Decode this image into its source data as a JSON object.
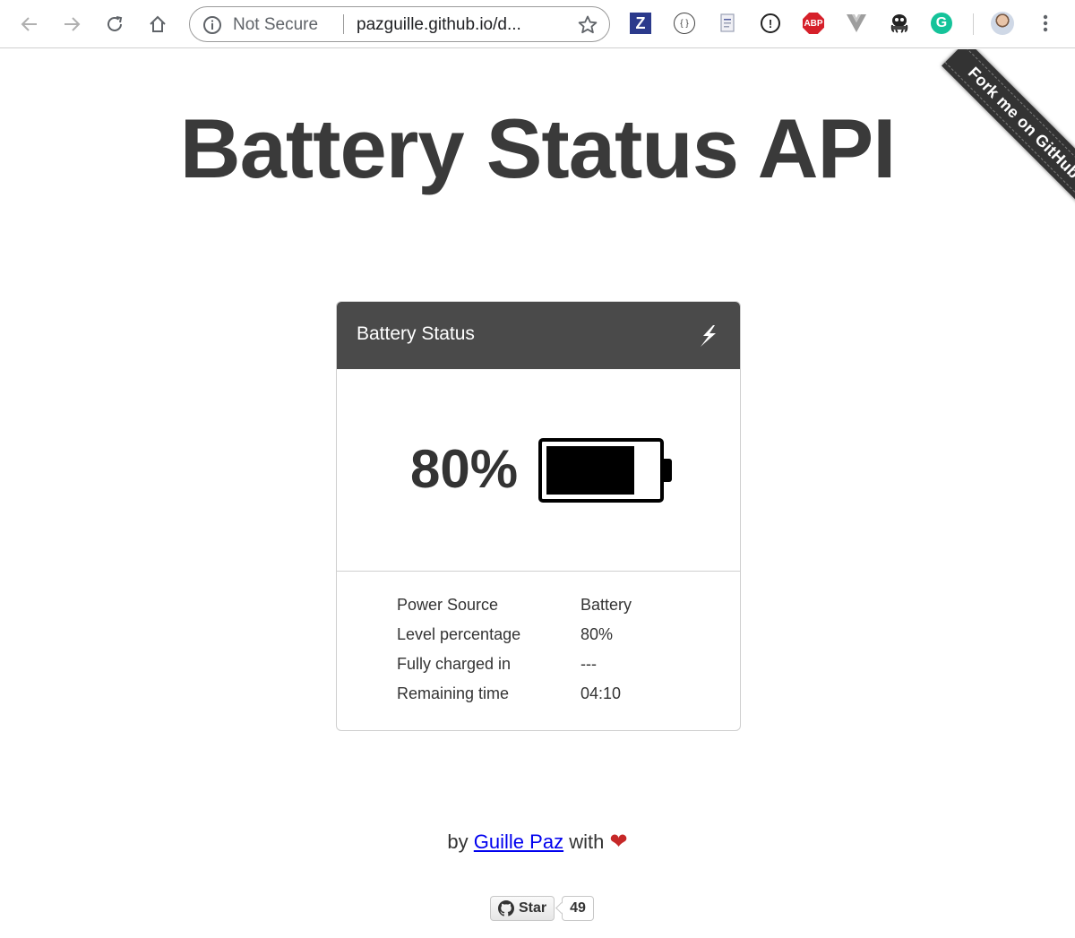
{
  "browser": {
    "security_label": "Not Secure",
    "url": "pazguille.github.io/d...",
    "extensions": [
      {
        "name": "zotero-icon",
        "label": "Z"
      },
      {
        "name": "json-viewer-icon",
        "label": "{ }"
      },
      {
        "name": "document-extension-icon",
        "label": ""
      },
      {
        "name": "password-manager-icon",
        "label": "!"
      },
      {
        "name": "adblock-plus-icon",
        "label": "ABP"
      },
      {
        "name": "vue-devtools-icon",
        "label": ""
      },
      {
        "name": "octopus-extension-icon",
        "label": ""
      },
      {
        "name": "grammarly-icon",
        "label": "G"
      },
      {
        "name": "profile-avatar",
        "label": ""
      }
    ]
  },
  "ribbon": {
    "label": "Fork me on GitHub"
  },
  "page": {
    "title": "Battery Status API"
  },
  "card": {
    "title": "Battery Status",
    "level_label": "80%",
    "level_fraction": 0.8,
    "details": [
      {
        "label": "Power Source",
        "value": "Battery"
      },
      {
        "label": "Level percentage",
        "value": "80%"
      },
      {
        "label": "Fully charged in",
        "value": "---"
      },
      {
        "label": "Remaining time",
        "value": "04:10"
      }
    ]
  },
  "footer": {
    "by": "by",
    "author": "Guille Paz",
    "with": "with",
    "heart": "❤"
  },
  "github_button": {
    "label": "Star",
    "count": "49"
  },
  "colors": {
    "card_header": "#4a4a4a",
    "heart": "#c62828",
    "link": "#0000ee"
  }
}
